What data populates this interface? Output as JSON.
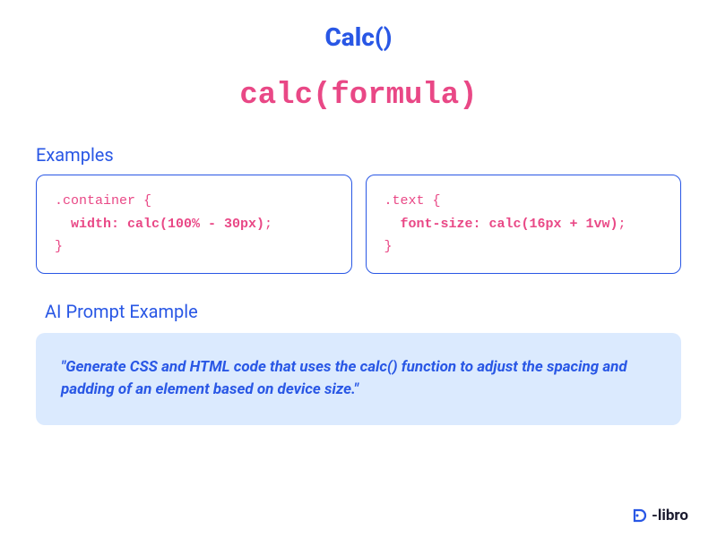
{
  "title": "Calc()",
  "syntax": "calc(formula)",
  "sections": {
    "examples": {
      "heading": "Examples",
      "codeBlocks": [
        {
          "selector": ".container {",
          "propIndent": "width: calc(100% - 30px)",
          "semi": ";",
          "close": "}"
        },
        {
          "selector": ".text {",
          "propIndent": "font-size: calc(16px + 1vw)",
          "semi": ";",
          "close": "}"
        }
      ]
    },
    "aiPrompt": {
      "heading": "AI Prompt Example",
      "text": "\"Generate CSS and HTML code that uses the calc() function to adjust the spacing and padding of an element based on device size.\""
    }
  },
  "brand": {
    "name": "-libro",
    "prefix": "D"
  }
}
